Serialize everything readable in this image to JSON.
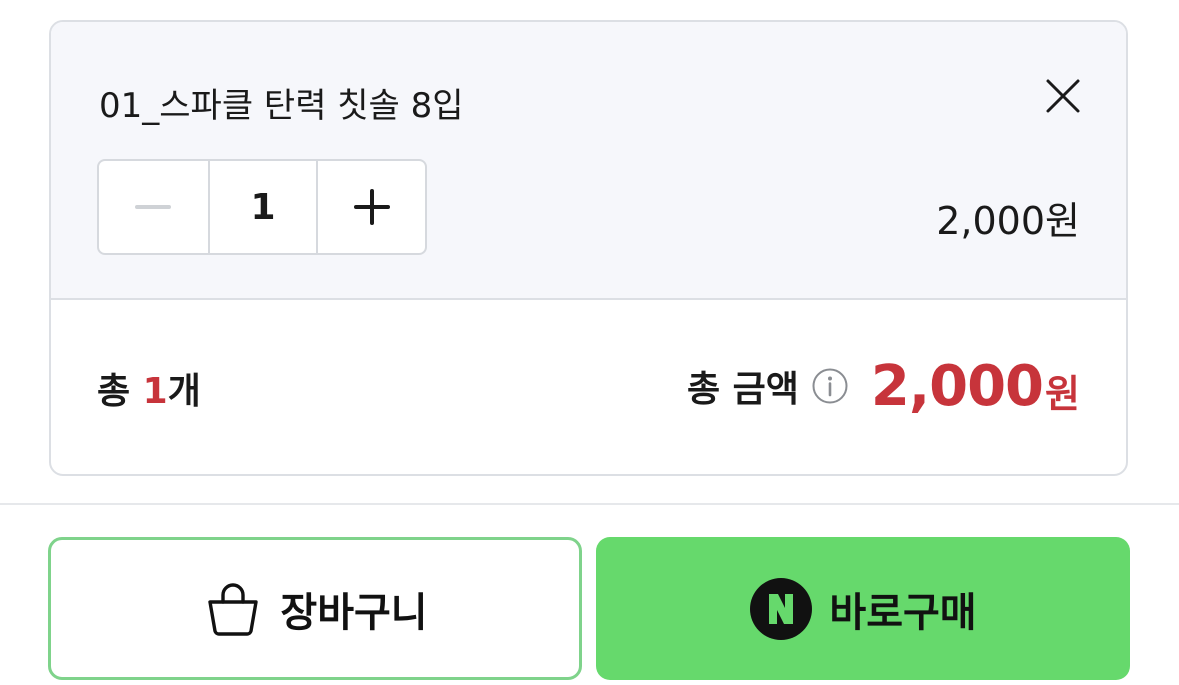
{
  "option": {
    "name": "01_스파클 탄력 칫솔 8입",
    "quantity": "1",
    "price": "2,000원"
  },
  "summary": {
    "count_prefix": "총 ",
    "count_value": "1",
    "count_suffix": "개",
    "total_label": "총 금액",
    "total_value": "2,000",
    "total_unit": "원"
  },
  "actions": {
    "cart_label": "장바구니",
    "buy_label": "바로구매"
  },
  "icons": {
    "close": "close-icon",
    "minus": "minus-icon",
    "plus": "plus-icon",
    "info": "info-icon",
    "cart": "shopping-bag-icon",
    "naver": "naver-n-icon"
  },
  "colors": {
    "accent_red": "#c7343b",
    "buy_green": "#66d96c",
    "cart_border": "#7fd38b"
  }
}
